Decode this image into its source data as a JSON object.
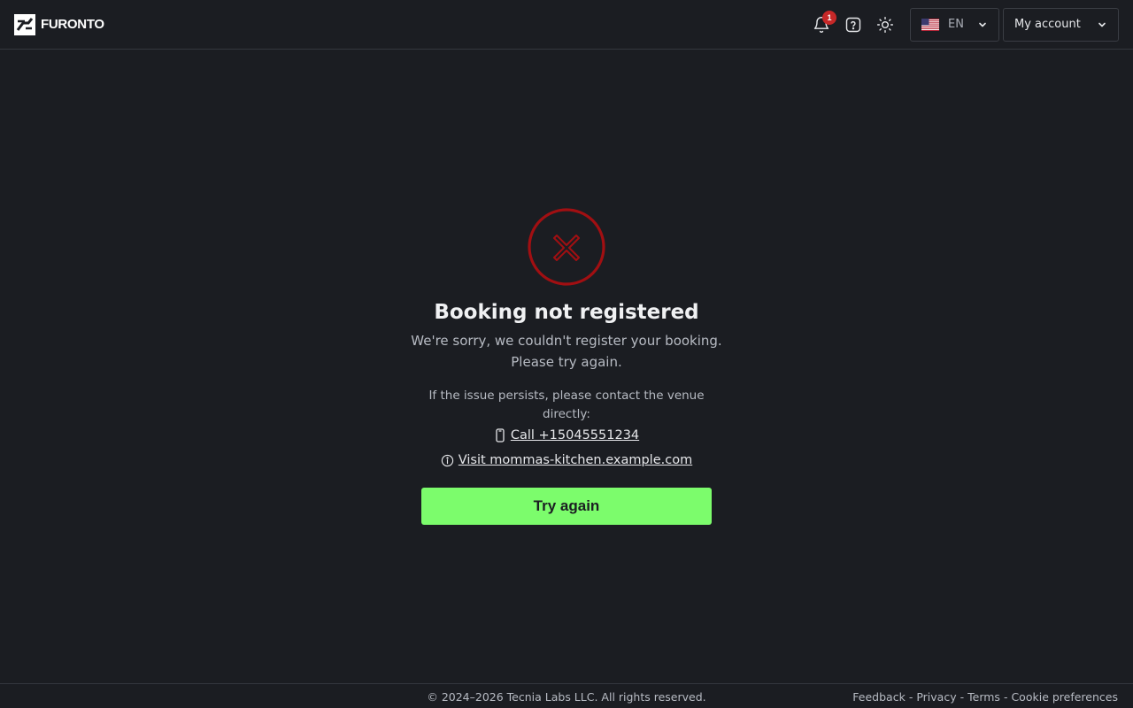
{
  "header": {
    "logo_text": "FURONTO",
    "notifications": {
      "icon": "bell-icon",
      "count": "1"
    },
    "help_icon": "question-icon",
    "theme_icon": "sun-icon",
    "language": {
      "flag": "us-flag",
      "code": "EN"
    },
    "account_label": "My account"
  },
  "main": {
    "status_icon": "error-x-icon",
    "title": "Booking not registered",
    "subtitle_line1": "We're sorry, we couldn't register your booking.",
    "subtitle_line2": "Please try again.",
    "persist_text": "If the issue persists, please contact the venue directly:",
    "call_link": "Call +15045551234",
    "visit_link": "Visit mommas-kitchen.example.com",
    "retry_button": "Try again"
  },
  "footer": {
    "copyright": "© 2024–2026 Tecnia Labs LLC. All rights reserved.",
    "links": [
      "Feedback",
      "Privacy",
      "Terms",
      "Cookie preferences"
    ],
    "separator": "-"
  },
  "colors": {
    "background": "#1b1d22",
    "accent_green": "#7cfc6c",
    "error_red": "#a10f12",
    "badge_red": "#c62828"
  }
}
